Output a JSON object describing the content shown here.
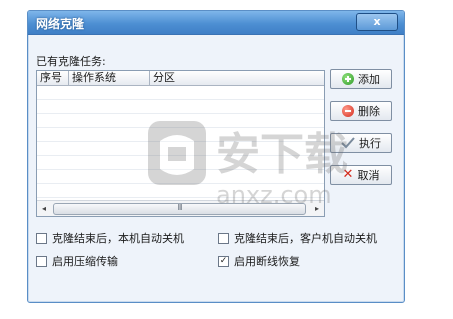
{
  "window": {
    "title": "网络克隆",
    "close_glyph": "x"
  },
  "task_list": {
    "label": "已有克隆任务:",
    "columns": [
      "序号",
      "操作系统",
      "分区"
    ],
    "rows": [],
    "scroll_left": "◂",
    "scroll_right": "▸",
    "scroll_grip": "III"
  },
  "buttons": {
    "add": "添加",
    "delete": "删除",
    "execute": "执行",
    "cancel": "取消"
  },
  "options": {
    "shutdown_local": {
      "label": "克隆结束后，本机自动关机",
      "checked": false
    },
    "shutdown_client": {
      "label": "克隆结束后，客户机自动关机",
      "checked": false
    },
    "compress": {
      "label": "启用压缩传输",
      "checked": false
    },
    "resume": {
      "label": "启用断线恢复",
      "checked": true
    }
  },
  "watermark": {
    "cn": "安下载",
    "en": "anxz.com"
  },
  "colors": {
    "accent": "#4d8fd3",
    "add_icon": "#2f9a2a",
    "delete_icon": "#d42a1c"
  }
}
